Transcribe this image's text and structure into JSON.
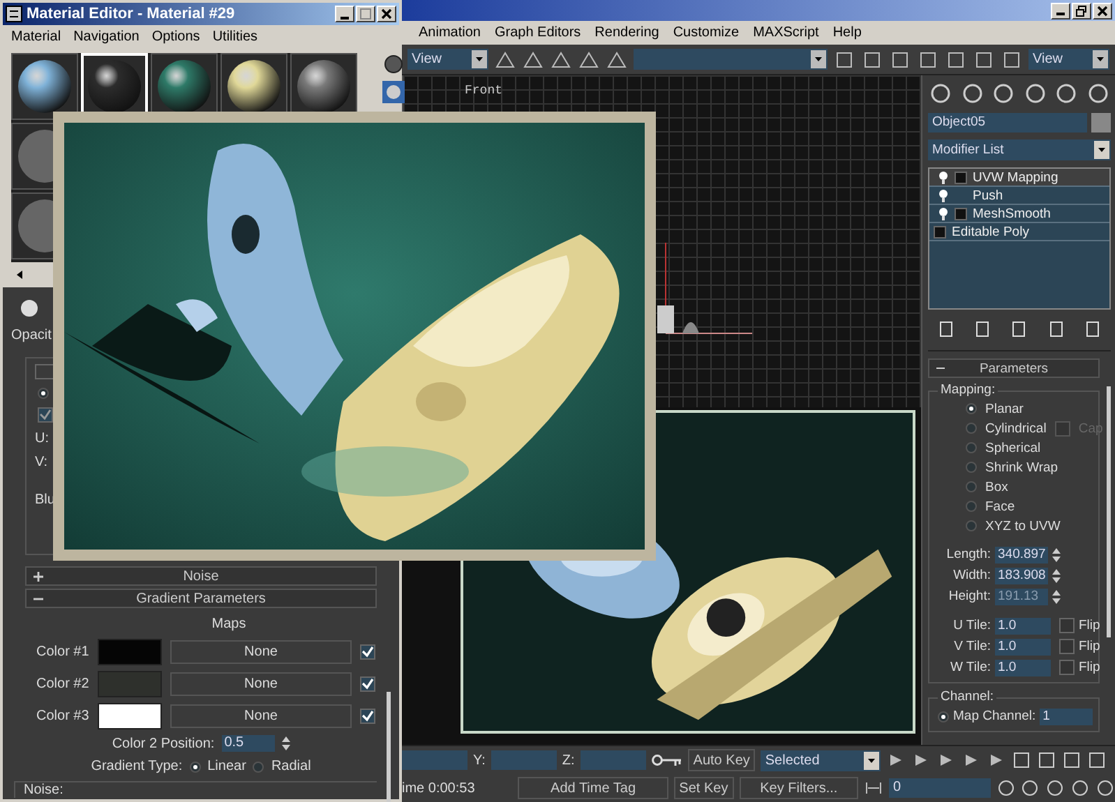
{
  "material_editor": {
    "title": "Material Editor - Material #29",
    "menu": [
      "Material",
      "Navigation",
      "Options",
      "Utilities"
    ],
    "samples": [
      {
        "color": "#7fb2d8",
        "selected": false
      },
      {
        "color": "#2c2c2c",
        "selected": true
      },
      {
        "color": "#2e7a68",
        "selected": false
      },
      {
        "color": "#e0d898",
        "selected": false
      },
      {
        "color": "#7a7a7a",
        "selected": false
      }
    ],
    "opacity_label": "Opacit",
    "panel_radio": {
      "selected": true
    },
    "panel_checkbox": {
      "checked": true
    },
    "u_label": "U:",
    "v_label": "V:",
    "blur_label": "Blu",
    "rollouts": [
      {
        "title": "Noise",
        "expanded": false
      },
      {
        "title": "Gradient Parameters",
        "expanded": true
      }
    ],
    "maps_label": "Maps",
    "colors": [
      {
        "label": "Color #1",
        "color": "#050505",
        "map": "None",
        "checked": true
      },
      {
        "label": "Color #2",
        "color": "#2e302c",
        "map": "None",
        "checked": true
      },
      {
        "label": "Color #3",
        "color": "#ffffff",
        "map": "None",
        "checked": true
      }
    ],
    "color2_position": {
      "label": "Color 2 Position:",
      "value": "0.5"
    },
    "gradient_type": {
      "label": "Gradient Type:",
      "options": [
        {
          "label": "Linear",
          "selected": true
        },
        {
          "label": "Radial",
          "selected": false
        }
      ]
    },
    "noise_group": "Noise:"
  },
  "main": {
    "menu": [
      "Animation",
      "Graph Editors",
      "Rendering",
      "Customize",
      "MAXScript",
      "Help"
    ],
    "toolbar": {
      "view_left": "View",
      "view_right": "View"
    },
    "viewport_label": "Front",
    "command_panel": {
      "object_name": "Object05",
      "modifier_list": "Modifier List",
      "stack": [
        {
          "label": "UVW Mapping",
          "selected": true,
          "expandable": true,
          "kind": "modifier"
        },
        {
          "label": "Push",
          "selected": false,
          "expandable": false,
          "kind": "modifier"
        },
        {
          "label": "MeshSmooth",
          "selected": false,
          "expandable": true,
          "kind": "modifier"
        },
        {
          "label": "Editable Poly",
          "selected": false,
          "expandable": true,
          "kind": "base"
        }
      ],
      "parameters": {
        "title": "Parameters",
        "mapping_label": "Mapping:",
        "mappings": [
          {
            "label": "Planar",
            "selected": true
          },
          {
            "label": "Cylindrical",
            "selected": false
          },
          {
            "label": "Spherical",
            "selected": false
          },
          {
            "label": "Shrink Wrap",
            "selected": false
          },
          {
            "label": "Box",
            "selected": false
          },
          {
            "label": "Face",
            "selected": false
          },
          {
            "label": "XYZ to UVW",
            "selected": false
          }
        ],
        "cap": {
          "label": "Cap",
          "checked": false,
          "disabled": true
        },
        "dims": [
          {
            "label": "Length:",
            "value": "340.897",
            "disabled": false
          },
          {
            "label": "Width:",
            "value": "183.908",
            "disabled": false
          },
          {
            "label": "Height:",
            "value": "191.13",
            "disabled": true
          }
        ],
        "tiles": [
          {
            "label": "U Tile:",
            "value": "1.0",
            "flip_label": "Flip",
            "flip": false
          },
          {
            "label": "V Tile:",
            "value": "1.0",
            "flip_label": "Flip",
            "flip": false
          },
          {
            "label": "W Tile:",
            "value": "1.0",
            "flip_label": "Flip",
            "flip": false
          }
        ],
        "channel_label": "Channel:",
        "map_channel": {
          "label": "Map Channel:",
          "value": "1",
          "selected": true
        }
      }
    }
  },
  "bottom": {
    "y_label": "Y:",
    "z_label": "Z:",
    "time": "ime  0:00:53",
    "add_time_tag": "Add Time Tag",
    "auto_key": "Auto Key",
    "key_mode": "Selected",
    "set_key": "Set Key",
    "key_filters": "Key Filters...",
    "frame": "0"
  }
}
